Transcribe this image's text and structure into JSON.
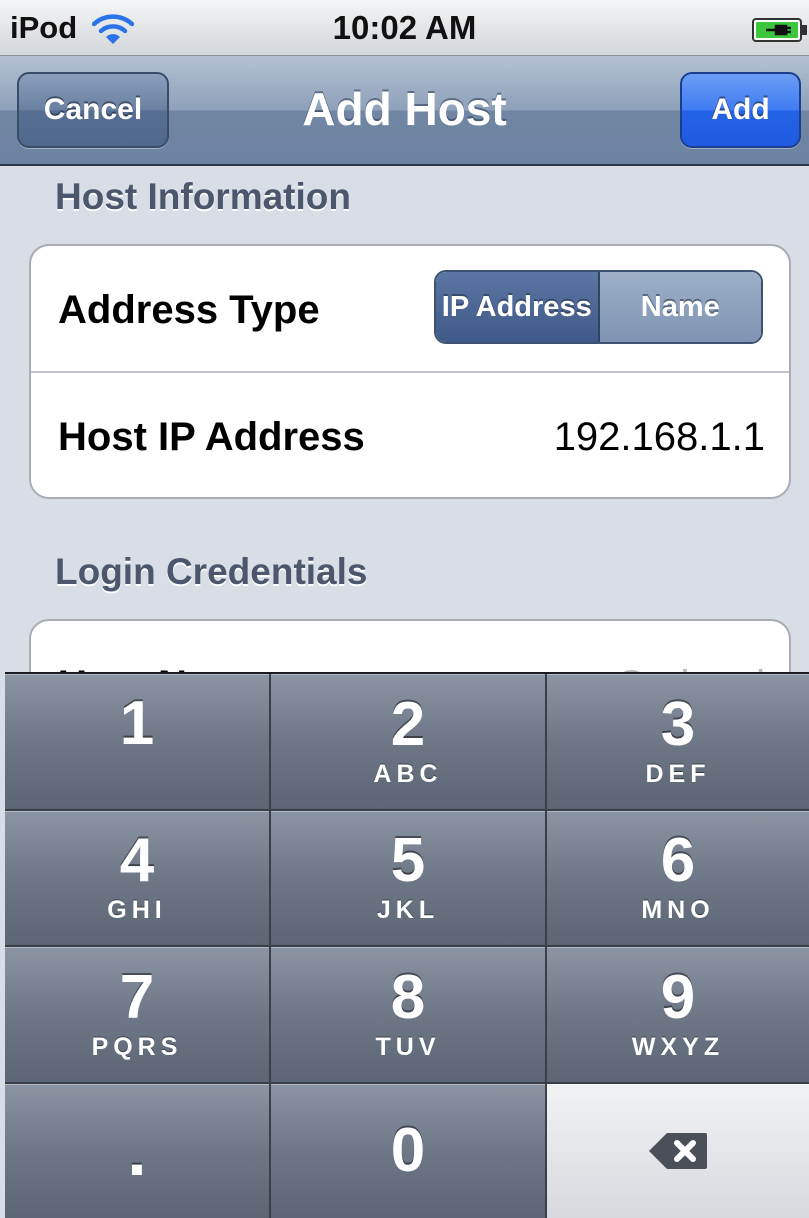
{
  "status_bar": {
    "carrier": "iPod",
    "time": "10:02 AM",
    "wifi_icon": "wifi-icon",
    "battery_icon": "battery-charging-icon"
  },
  "nav": {
    "title": "Add Host",
    "cancel_label": "Cancel",
    "add_label": "Add"
  },
  "sections": {
    "host_info": {
      "header": "Host Information",
      "address_type_label": "Address Type",
      "segments": [
        "IP Address",
        "Name"
      ],
      "selected_segment": "IP Address",
      "host_ip_label": "Host IP Address",
      "host_ip_value": "192.168.1.1"
    },
    "login": {
      "header": "Login Credentials",
      "user_name_label": "User Name",
      "user_name_placeholder": "Optional"
    }
  },
  "keypad": {
    "keys": [
      {
        "digit": "1",
        "letters": ""
      },
      {
        "digit": "2",
        "letters": "ABC"
      },
      {
        "digit": "3",
        "letters": "DEF"
      },
      {
        "digit": "4",
        "letters": "GHI"
      },
      {
        "digit": "5",
        "letters": "JKL"
      },
      {
        "digit": "6",
        "letters": "MNO"
      },
      {
        "digit": "7",
        "letters": "PQRS"
      },
      {
        "digit": "8",
        "letters": "TUV"
      },
      {
        "digit": "9",
        "letters": "WXYZ"
      },
      {
        "digit": "."
      },
      {
        "digit": "0"
      },
      {
        "icon": "backspace-icon"
      }
    ]
  },
  "colors": {
    "nav_bar": "#7a8fab",
    "add_button": "#2a6ae8",
    "section_header": "#4c566c",
    "page_background": "#d9dde5"
  }
}
